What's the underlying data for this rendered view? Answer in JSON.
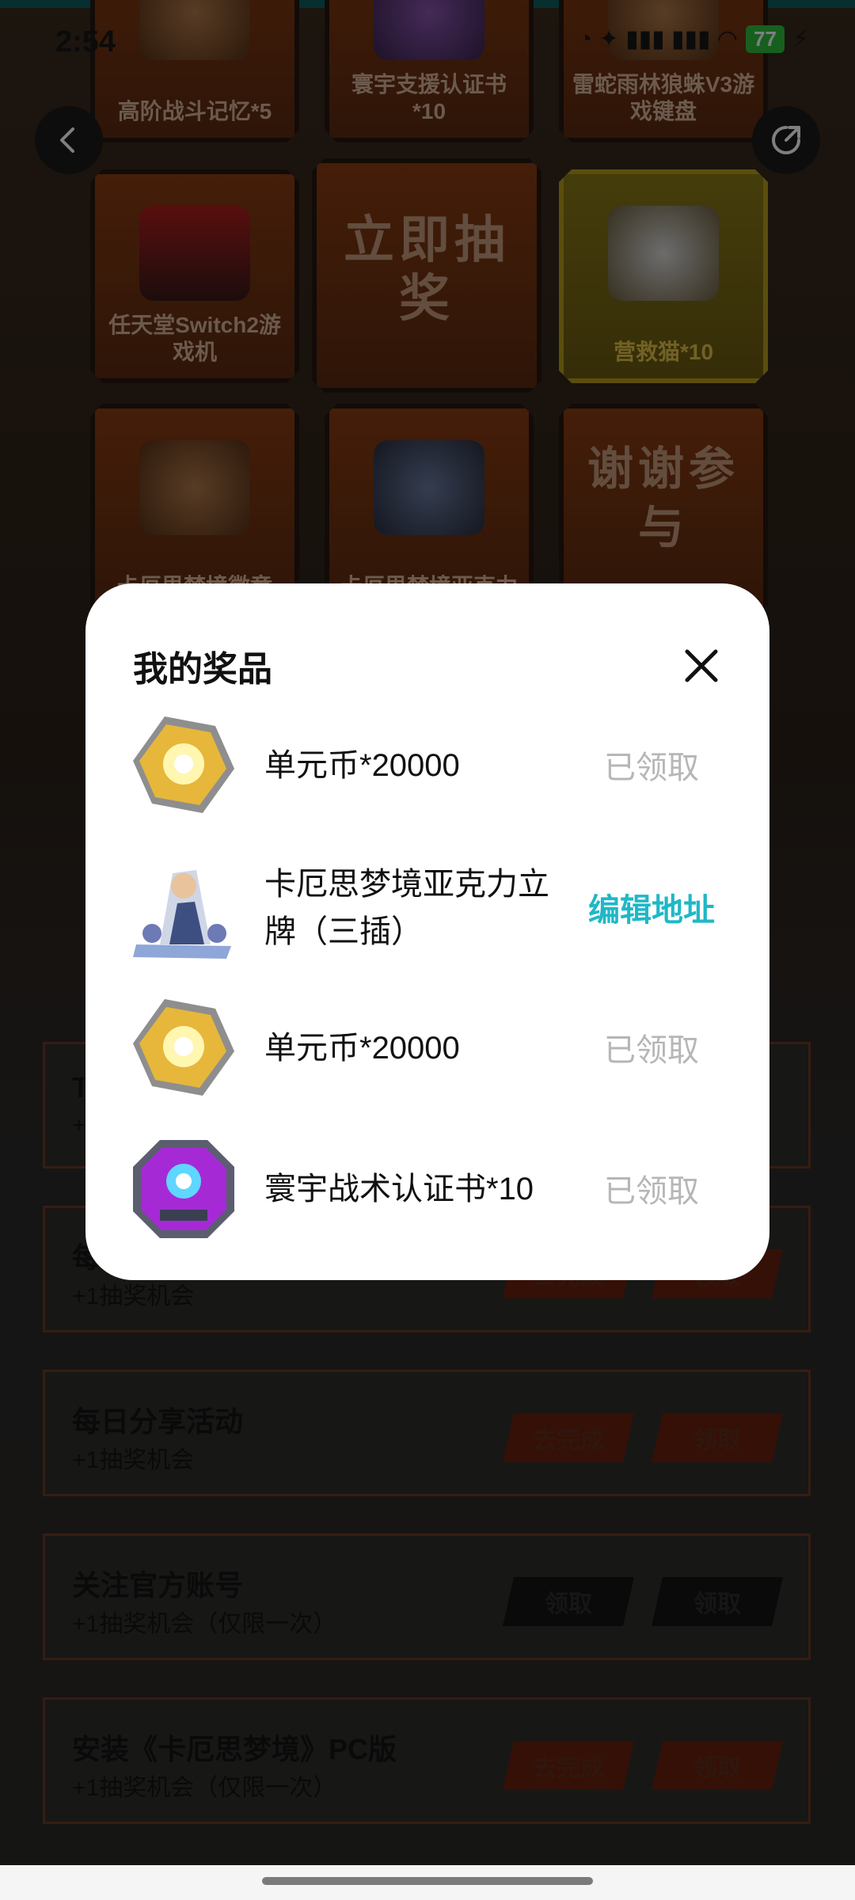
{
  "status_bar": {
    "time": "2:54",
    "battery": "77",
    "signals": "◔ ✦ ▮▮▮ ▮▮▮ ◠",
    "charging": "⚡"
  },
  "prizes": [
    {
      "label": "高阶战斗记忆*5"
    },
    {
      "label": "寰宇支援认证书*10"
    },
    {
      "label": "雷蛇雨林狼蛛V3游戏键盘"
    },
    {
      "label": "任天堂Switch2游戏机"
    },
    {
      "label": "立即抽奖"
    },
    {
      "label": "营救猫*10"
    },
    {
      "label": "卡厄思梦境徽章"
    },
    {
      "label": "卡厄思梦境亚克力"
    },
    {
      "label": "谢谢参与"
    }
  ],
  "tasks": [
    {
      "title": "T",
      "sub": "+1",
      "btn1": "",
      "btn2": ""
    },
    {
      "title": "每",
      "sub": "+1抽奖机会",
      "btn1": "去完成",
      "btn2": "领取"
    },
    {
      "title": "每日分享活动",
      "sub": "+1抽奖机会",
      "btn1": "去完成",
      "btn2": "领取"
    },
    {
      "title": "关注官方账号",
      "sub": "+1抽奖机会（仅限一次）",
      "btn1": "领取",
      "btn2": "领取"
    },
    {
      "title": "安装《卡厄思梦境》PC版",
      "sub": "+1抽奖机会（仅限一次）",
      "btn1": "去完成",
      "btn2": "领取"
    }
  ],
  "modal": {
    "title": "我的奖品",
    "items": [
      {
        "name": "单元币*20000",
        "status": "已领取",
        "icon": "gold-coin-icon"
      },
      {
        "name": "卡厄思梦境亚克力立牌（三插）",
        "status": "编辑地址",
        "icon": "acrylic-stand-icon"
      },
      {
        "name": "单元币*20000",
        "status": "已领取",
        "icon": "gold-coin-icon"
      },
      {
        "name": "寰宇战术认证书*10",
        "status": "已领取",
        "icon": "purple-certificate-icon"
      }
    ]
  },
  "colors": {
    "accent": "#1fb8c6",
    "claimed": "#b6b6b6",
    "tile": "#8a3c12"
  }
}
